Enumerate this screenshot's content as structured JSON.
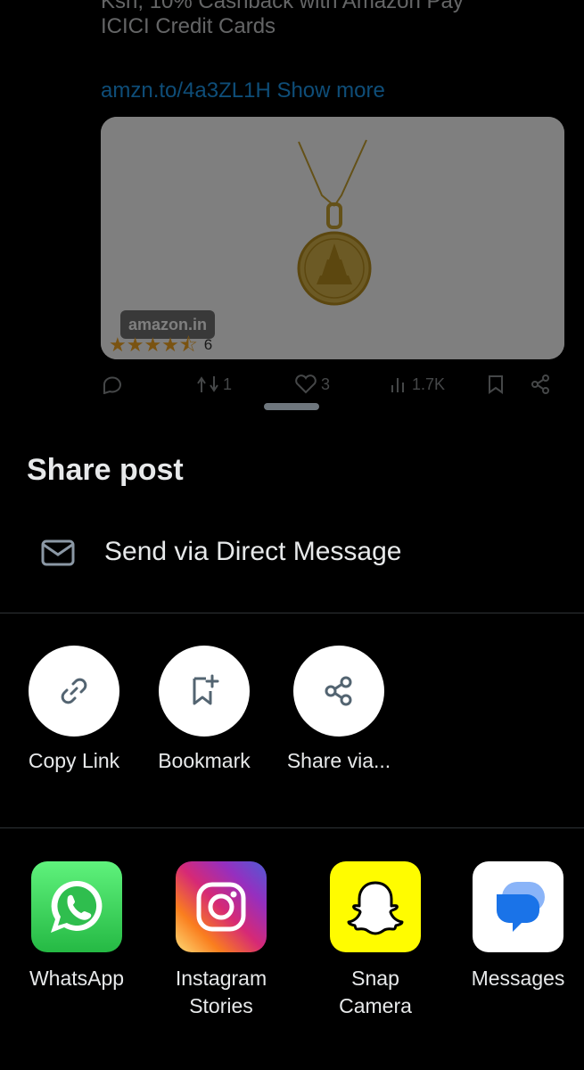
{
  "post": {
    "text_line1": "Ksh, 10% Cashback with Amazon Pay",
    "text_line2": "ICICI Credit Cards",
    "link": "amzn.to/4a3ZL1H Show more",
    "card": {
      "domain": "amazon.in",
      "rating": 4.5,
      "stars": "★★★★⯪",
      "review_count": "6"
    },
    "actions": {
      "replies": "",
      "reposts": "1",
      "likes": "3",
      "views": "1.7K"
    }
  },
  "sheet": {
    "title": "Share post",
    "dm_label": "Send via Direct Message",
    "actions": [
      {
        "label": "Copy Link",
        "icon": "link-icon"
      },
      {
        "label": "Bookmark",
        "icon": "bookmark-add-icon"
      },
      {
        "label": "Share via...",
        "icon": "share-icon"
      }
    ],
    "apps": [
      {
        "label": "WhatsApp",
        "icon": "whatsapp-icon",
        "color": "#25D366"
      },
      {
        "label": "Instagram Stories",
        "icon": "instagram-icon",
        "color": "#E1306C"
      },
      {
        "label": "Snap Camera",
        "icon": "snapchat-icon",
        "color": "#FFFC00"
      },
      {
        "label": "Messages",
        "icon": "google-messages-icon",
        "color": "#1A73E8"
      }
    ]
  }
}
